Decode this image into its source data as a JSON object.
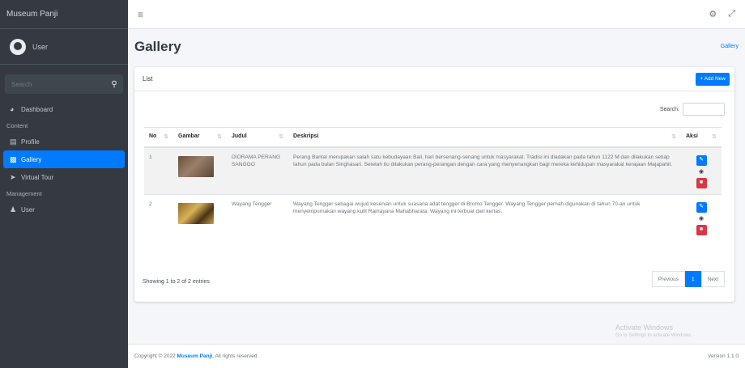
{
  "brand": "Museum Panji",
  "user": {
    "name": "User"
  },
  "sidebar": {
    "search_placeholder": "Search",
    "items": [
      {
        "label": "Dashboard",
        "icon": "dashboard-icon"
      },
      {
        "header": "Content"
      },
      {
        "label": "Profile",
        "icon": "profile-icon"
      },
      {
        "label": "Gallery",
        "icon": "gallery-icon",
        "active": true
      },
      {
        "label": "Virtual Tour",
        "icon": "tour-icon"
      },
      {
        "header": "Management"
      },
      {
        "label": "User",
        "icon": "users-icon"
      }
    ]
  },
  "page": {
    "title": "Gallery",
    "breadcrumb": "Gallery"
  },
  "card": {
    "title": "List",
    "add_button": "+ Add New",
    "search_label": "Search:",
    "columns": [
      "No",
      "Gambar",
      "Judul",
      "Deskripsi",
      "Aksi"
    ],
    "rows": [
      {
        "no": "1",
        "judul": "DIORAMA PERANG SANGGO",
        "deskripsi": "Perang Bantal merupakan salah satu kebudayaan Bali, hari bersenang-senang untuk masyarakat. Tradisi ini diadakan pada tahun 1122 M dan dilakukan setiap tahun pada bulan Singhasari. Setelah itu dilakukan perang-perangan dengan cara yang menyenangkan bagi mereka kehidupan masyarakat kerajaan Majapahit."
      },
      {
        "no": "2",
        "judul": "Wayang Tengger",
        "deskripsi": "Wayang Tengger sebagai wujud kesenian untuk suasana adat tengger di Bromo Tengger. Wayang Tengger pernah digunakan di tahun 70-an untuk menyempurnakan wayang kulit Ramayana Mahabharata. Wayang ini terbuat dari kertas."
      }
    ],
    "info": "Showing 1 to 2 of 2 entries",
    "pager": {
      "prev": "Previous",
      "current": "1",
      "next": "Next"
    }
  },
  "watermark": {
    "title": "Activate Windows",
    "sub": "Go to Settings to activate Windows."
  },
  "footer": {
    "copyright_prefix": "Copyright © 2022",
    "copyright_link": "Museum Panji.",
    "copyright_suffix": "All rights reserved.",
    "version": "Version 1.1.0"
  },
  "colors": {
    "primary": "#007bff",
    "danger": "#dc3545",
    "sidebar": "#343a40"
  }
}
